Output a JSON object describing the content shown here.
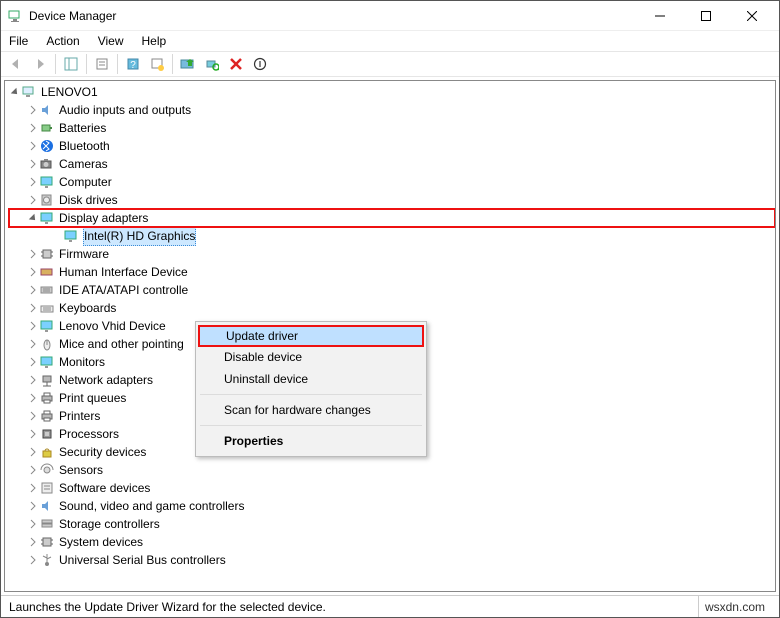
{
  "window": {
    "title": "Device Manager"
  },
  "menus": {
    "file": "File",
    "action": "Action",
    "view": "View",
    "help": "Help"
  },
  "root": "LENOVO1",
  "categories": [
    {
      "label": "Audio inputs and outputs",
      "icon": "speaker"
    },
    {
      "label": "Batteries",
      "icon": "battery"
    },
    {
      "label": "Bluetooth",
      "icon": "bluetooth"
    },
    {
      "label": "Cameras",
      "icon": "camera"
    },
    {
      "label": "Computer",
      "icon": "monitor"
    },
    {
      "label": "Disk drives",
      "icon": "disk"
    },
    {
      "label": "Display adapters",
      "icon": "monitor",
      "redbox": true,
      "expanded": true,
      "children": [
        {
          "label": "Intel(R) HD Graphics",
          "icon": "monitor",
          "selected": true
        }
      ]
    },
    {
      "label": "Firmware",
      "icon": "chip"
    },
    {
      "label": "Human Interface Device",
      "icon": "hid",
      "truncated": true
    },
    {
      "label": "IDE ATA/ATAPI controlle",
      "icon": "ide",
      "truncated": true
    },
    {
      "label": "Keyboards",
      "icon": "keyboard"
    },
    {
      "label": "Lenovo Vhid Device",
      "icon": "monitor"
    },
    {
      "label": "Mice and other pointing",
      "icon": "mouse",
      "truncated": true
    },
    {
      "label": "Monitors",
      "icon": "monitor"
    },
    {
      "label": "Network adapters",
      "icon": "network"
    },
    {
      "label": "Print queues",
      "icon": "printer"
    },
    {
      "label": "Printers",
      "icon": "printer"
    },
    {
      "label": "Processors",
      "icon": "cpu"
    },
    {
      "label": "Security devices",
      "icon": "lock"
    },
    {
      "label": "Sensors",
      "icon": "sensor"
    },
    {
      "label": "Software devices",
      "icon": "software"
    },
    {
      "label": "Sound, video and game controllers",
      "icon": "speaker"
    },
    {
      "label": "Storage controllers",
      "icon": "storage"
    },
    {
      "label": "System devices",
      "icon": "chip"
    },
    {
      "label": "Universal Serial Bus controllers",
      "icon": "usb"
    }
  ],
  "context_menu": {
    "update": "Update driver",
    "disable": "Disable device",
    "uninstall": "Uninstall device",
    "scan": "Scan for hardware changes",
    "properties": "Properties"
  },
  "status": {
    "left": "Launches the Update Driver Wizard for the selected device.",
    "right": "wsxdn.com"
  }
}
